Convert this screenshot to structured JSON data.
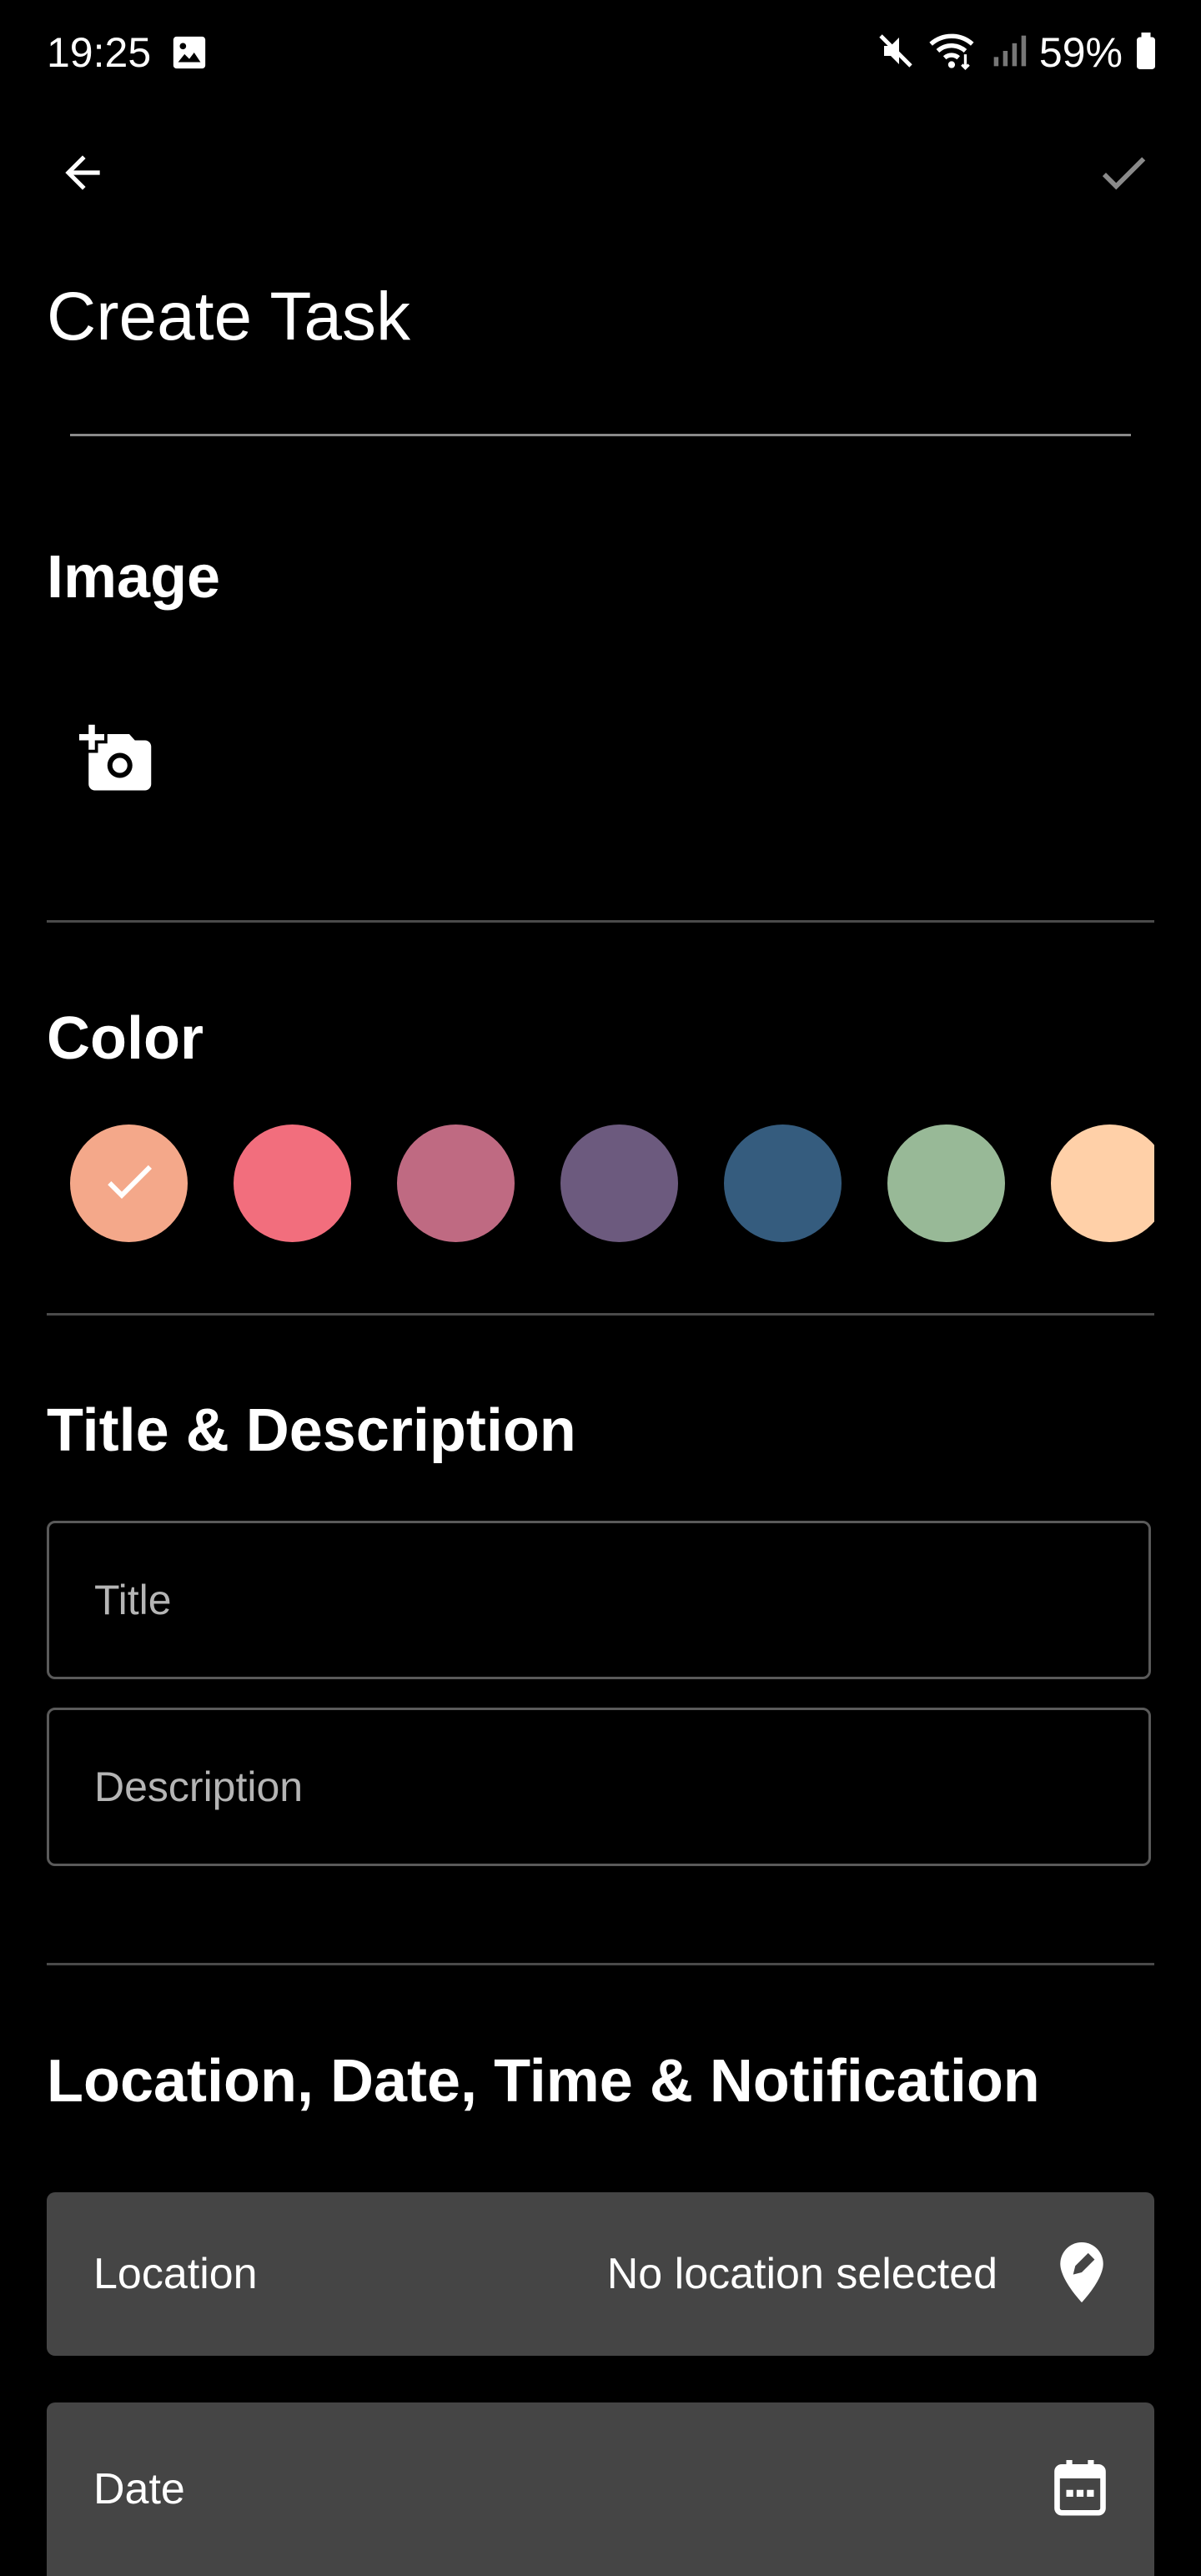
{
  "status_bar": {
    "time": "19:25",
    "battery": "59%",
    "icons": [
      "gallery-icon",
      "mute-icon",
      "wifi-icon",
      "signal-icon",
      "battery-icon"
    ]
  },
  "app_bar": {
    "back_icon": "arrow-back-icon",
    "confirm_icon": "check-icon",
    "title": "Create Task"
  },
  "sections": {
    "image": {
      "title": "Image",
      "add_icon": "add-photo-icon"
    },
    "color": {
      "title": "Color",
      "options": [
        {
          "hex": "#F4A88A",
          "selected": true
        },
        {
          "hex": "#F26E7D",
          "selected": false
        },
        {
          "hex": "#BF6A82",
          "selected": false
        },
        {
          "hex": "#6C5A7E",
          "selected": false
        },
        {
          "hex": "#355C7E",
          "selected": false
        },
        {
          "hex": "#98B997",
          "selected": false
        },
        {
          "hex": "#FFD0A8",
          "selected": false
        }
      ]
    },
    "title_description": {
      "title": "Title & Description",
      "title_placeholder": "Title",
      "description_placeholder": "Description"
    },
    "location_date": {
      "title": "Location, Date, Time & Notification",
      "location_label": "Location",
      "location_value": "No location selected",
      "location_icon": "location-pin-icon",
      "date_label": "Date",
      "date_icon": "calendar-icon"
    }
  },
  "colors": {
    "background": "#000000",
    "tile": "#454545",
    "divider": "#4a4a4a"
  }
}
